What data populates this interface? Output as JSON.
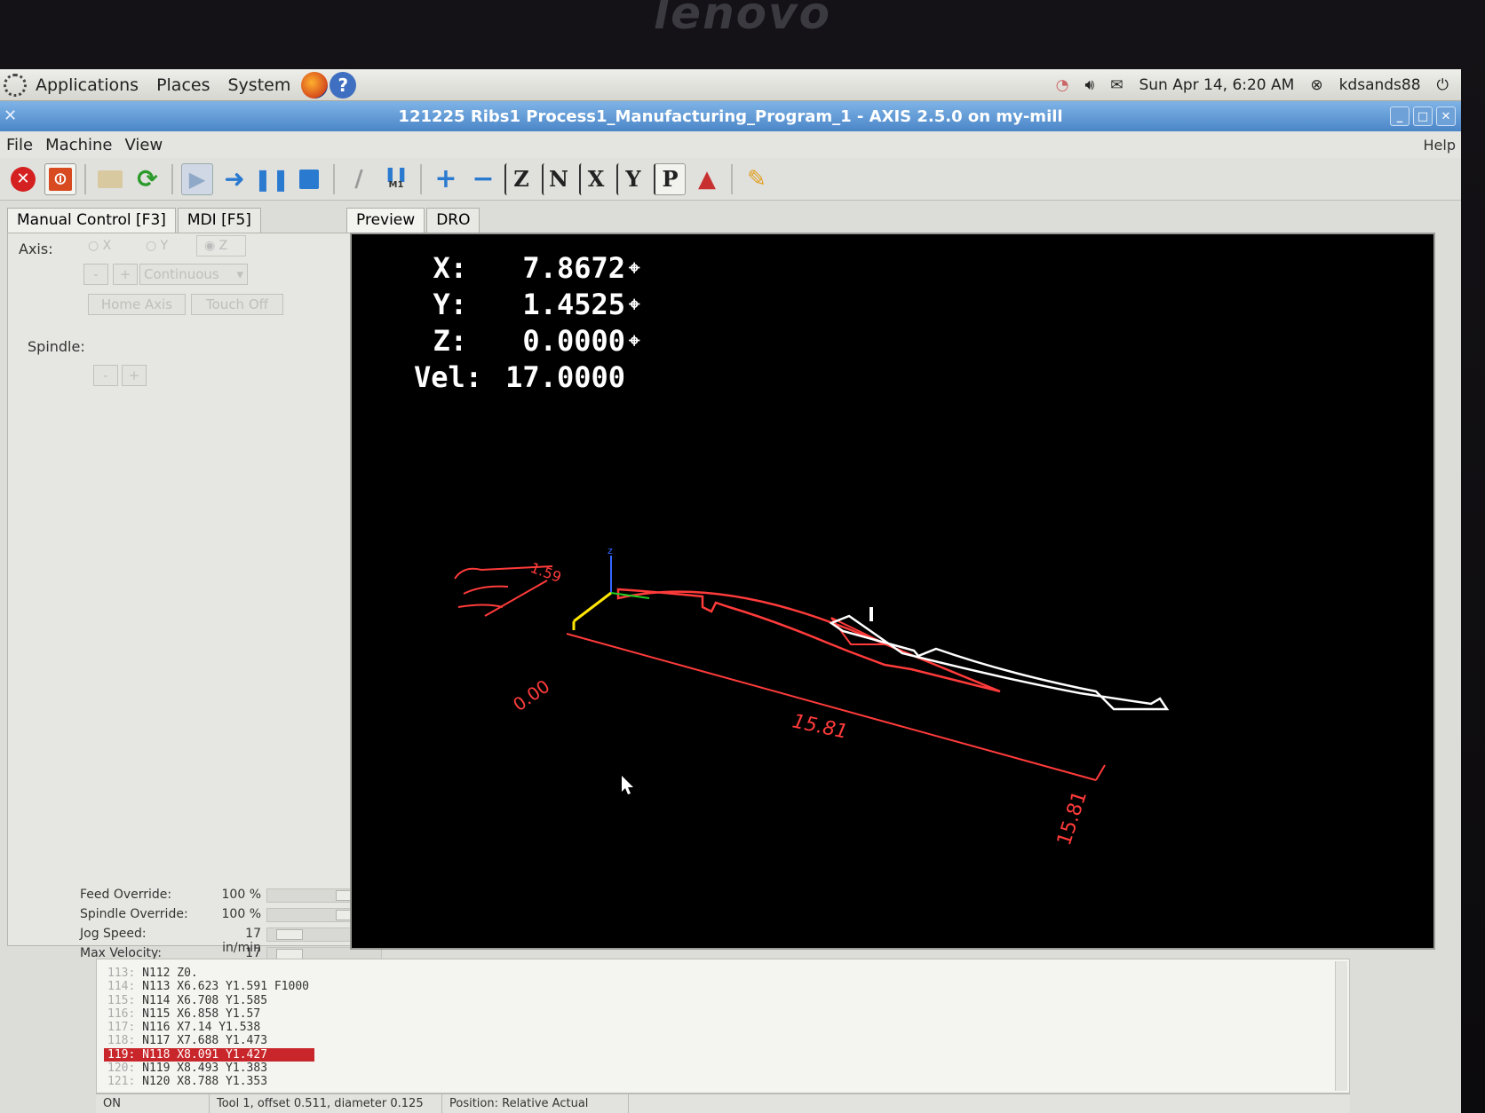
{
  "bezel": {
    "brand": "lenovo"
  },
  "top_panel": {
    "menus": [
      "Applications",
      "Places",
      "System"
    ],
    "clock": "Sun Apr 14,  6:20 AM",
    "user": "kdsands88"
  },
  "window": {
    "title": "121225 Ribs1 Process1_Manufacturing_Program_1 - AXIS 2.5.0 on my-mill"
  },
  "menubar": {
    "items": [
      "File",
      "Machine",
      "View"
    ],
    "help": "Help"
  },
  "toolbar": {
    "view_letters": [
      "Z",
      "N",
      "X",
      "Y",
      "P"
    ],
    "m1_label": "M1"
  },
  "left_tabs": [
    "Manual Control [F3]",
    "MDI [F5]"
  ],
  "manual": {
    "axis_label": "Axis:",
    "axes": [
      "X",
      "Y",
      "Z"
    ],
    "selected_axis": "Z",
    "jog_minus": "-",
    "jog_plus": "+",
    "jog_mode": "Continuous",
    "home_axis": "Home Axis",
    "touch_off": "Touch Off",
    "spindle_label": "Spindle:",
    "spindle_minus": "-",
    "spindle_plus": "+"
  },
  "overrides": [
    {
      "name": "Feed Override:",
      "value": "100 %",
      "level": 0.8
    },
    {
      "name": "Spindle Override:",
      "value": "100 %",
      "level": 0.8
    },
    {
      "name": "Jog Speed:",
      "value": "17 in/min",
      "level": 0.1
    },
    {
      "name": "Max Velocity:",
      "value": "17 in/min",
      "level": 0.1
    }
  ],
  "right_tabs": [
    "Preview",
    "DRO"
  ],
  "dro": {
    "x_label": "X:",
    "x": "7.8672",
    "y_label": "Y:",
    "y": "1.4525",
    "z_label": "Z:",
    "z": "0.0000",
    "vel_label": "Vel:",
    "vel": "17.0000",
    "home_symbol": "⌖"
  },
  "preview": {
    "dims": [
      "15.81",
      "15.81",
      "0.00",
      "1.59"
    ],
    "colors": {
      "red": "#ff3b3b",
      "white": "#ffffff",
      "yellow": "#ffe600",
      "green": "#22cc22",
      "blue": "#3366ff"
    }
  },
  "gcode": [
    {
      "n": "113:",
      "code": "N112 Z0."
    },
    {
      "n": "114:",
      "code": "N113 X6.623 Y1.591 F1000"
    },
    {
      "n": "115:",
      "code": "N114 X6.708 Y1.585"
    },
    {
      "n": "116:",
      "code": "N115 X6.858 Y1.57"
    },
    {
      "n": "117:",
      "code": "N116 X7.14 Y1.538"
    },
    {
      "n": "118:",
      "code": "N117 X7.688 Y1.473"
    },
    {
      "n": "119:",
      "code": "N118 X8.091 Y1.427",
      "active": true
    },
    {
      "n": "120:",
      "code": "N119 X8.493 Y1.383"
    },
    {
      "n": "121:",
      "code": "N120 X8.788 Y1.353"
    }
  ],
  "status": {
    "state": "ON",
    "tool": "Tool 1, offset 0.511, diameter 0.125",
    "position": "Position: Relative Actual"
  }
}
